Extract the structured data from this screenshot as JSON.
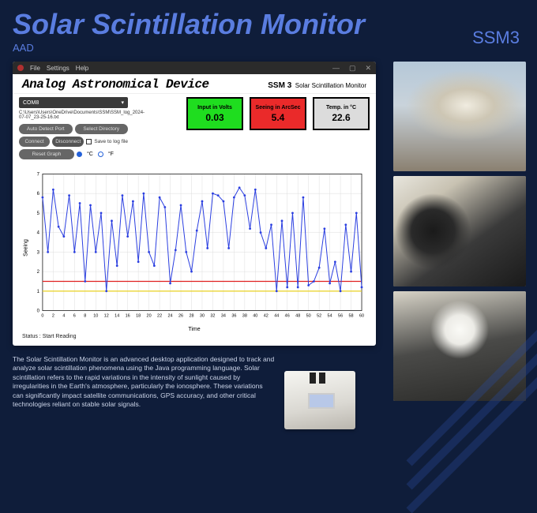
{
  "header": {
    "title": "Solar Scintillation Monitor",
    "subtitle": "AAD",
    "model": "SSM3"
  },
  "app": {
    "menu": {
      "file": "File",
      "settings": "Settings",
      "help": "Help"
    },
    "title": "Analog Astronomical Device",
    "model_label": "SSM 3",
    "model_sub": "Solar Scintillation Monitor",
    "com_port": "COM8",
    "path": "C:\\Users\\Users\\OneDrive\\Documents\\SSM\\SSM_log_2024-07-07_23-25-16.txt",
    "buttons": {
      "auto_detect": "Auto Detect Port",
      "select_dir": "Select Directory",
      "connect": "Connect",
      "disconnect": "Disconnect",
      "reset": "Reset Graph"
    },
    "checkbox_label": "Save to log file",
    "temp_units": {
      "c": "°C",
      "f": "°F",
      "selected": "c"
    },
    "readouts": {
      "volts_label": "Input in Volts",
      "volts_value": "0.03",
      "seeing_label": "Seeing in ArcSec",
      "seeing_value": "5.4",
      "temp_label": "Temp. in °C",
      "temp_value": "22.6"
    },
    "axis": {
      "x": "Time",
      "y": "Seeing"
    },
    "status_label": "Status :",
    "status_value": "Start Reading"
  },
  "chart_data": {
    "type": "line",
    "xlabel": "Time",
    "ylabel": "Seeing",
    "ylim": [
      0,
      7
    ],
    "x": [
      0,
      1,
      2,
      3,
      4,
      5,
      6,
      7,
      8,
      9,
      10,
      11,
      12,
      13,
      14,
      15,
      16,
      17,
      18,
      19,
      20,
      21,
      22,
      23,
      24,
      25,
      26,
      27,
      28,
      29,
      30,
      31,
      32,
      33,
      34,
      35,
      36,
      37,
      38,
      39,
      40,
      41,
      42,
      43,
      44,
      45,
      46,
      47,
      48,
      49,
      50,
      51,
      52,
      53,
      54,
      55,
      56,
      57,
      58,
      59,
      60
    ],
    "values": [
      5.8,
      3.0,
      6.2,
      4.3,
      3.8,
      5.9,
      3.0,
      5.5,
      1.5,
      5.4,
      3.0,
      5.0,
      1.0,
      4.6,
      2.3,
      5.9,
      3.8,
      5.6,
      2.5,
      6.0,
      3.0,
      2.3,
      5.8,
      5.3,
      1.4,
      3.1,
      5.4,
      3.0,
      2.0,
      4.1,
      5.6,
      3.2,
      6.0,
      5.9,
      5.6,
      3.2,
      5.8,
      6.3,
      5.9,
      4.2,
      6.2,
      4.0,
      3.2,
      4.4,
      1.0,
      4.6,
      1.2,
      5.0,
      1.2,
      5.8,
      1.3,
      1.5,
      2.2,
      4.2,
      1.4,
      2.5,
      1.0,
      4.4,
      2.0,
      5.0,
      1.2
    ],
    "ref_lines": [
      {
        "y": 1.5,
        "color": "#e02020"
      },
      {
        "y": 1.0,
        "color": "#e8d020"
      }
    ]
  },
  "description": "The Solar Scintillation Monitor is an advanced desktop application designed to track and analyze solar scintillation phenomena using the Java programming language. Solar scintillation refers to the rapid variations in the intensity of sunlight caused by irregularities in the Earth's atmosphere, particularly the ionosphere. These variations can significantly impact satellite communications, GPS accuracy, and other critical technologies reliant on stable solar signals."
}
